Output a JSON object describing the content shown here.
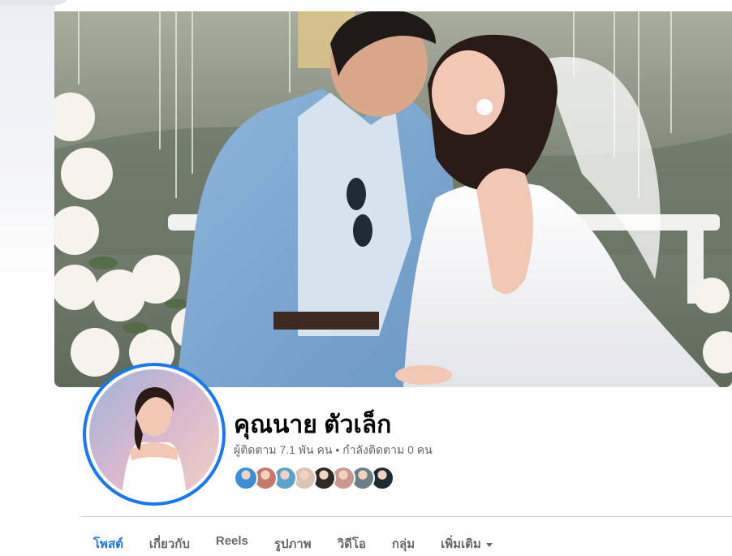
{
  "profile": {
    "name": "คุณนาย ตัวเล็ก",
    "followers_text": "ผู้ติดตาม 7.1 พัน คน • กำลังติดตาม 0 คน"
  },
  "friends": [
    {
      "name": "friend-1",
      "color": "#3b8fd6"
    },
    {
      "name": "friend-2",
      "color": "#c7786a"
    },
    {
      "name": "friend-3",
      "color": "#5aa3c9"
    },
    {
      "name": "friend-4",
      "color": "#d9c3b5"
    },
    {
      "name": "friend-5",
      "color": "#2e2a28"
    },
    {
      "name": "friend-6",
      "color": "#c99a8a"
    },
    {
      "name": "friend-7",
      "color": "#6d7f86"
    },
    {
      "name": "friend-8",
      "color": "#1f2b33"
    }
  ],
  "tabs": [
    {
      "label": "โพสต์",
      "active": true
    },
    {
      "label": "เกี่ยวกับ"
    },
    {
      "label": "Reels"
    },
    {
      "label": "รูปภาพ"
    },
    {
      "label": "วิดีโอ"
    },
    {
      "label": "กลุ่ม"
    },
    {
      "label": "เพิ่มเติม",
      "dropdown": true
    }
  ],
  "colors": {
    "accent": "#1877f2",
    "name_text": "#050505",
    "secondary_text": "#65676b",
    "suit": "#7fa9d3",
    "dress": "#f4f4f6"
  },
  "icons": {
    "more_dropdown": "caret-down-icon"
  }
}
